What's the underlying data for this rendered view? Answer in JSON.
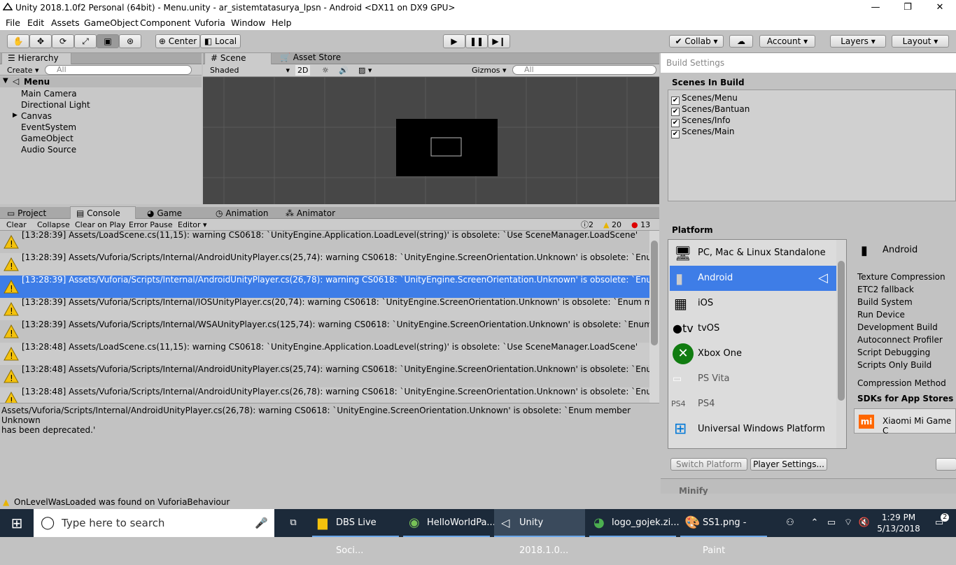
{
  "window": {
    "title": "Unity 2018.1.0f2 Personal (64bit) - Menu.unity - ar_sistemtatasurya_lpsn - Android <DX11 on DX9 GPU>"
  },
  "menu": [
    "File",
    "Edit",
    "Assets",
    "GameObject",
    "Component",
    "Vuforia",
    "Window",
    "Help"
  ],
  "toolbar": {
    "center": "Center",
    "local": "Local",
    "collab": "Collab",
    "account": "Account",
    "layers": "Layers",
    "layout": "Layout"
  },
  "hierarchy": {
    "tab": "Hierarchy",
    "create": "Create",
    "search": "All",
    "scene": "Menu",
    "items": [
      "Main Camera",
      "Directional Light",
      "Canvas",
      "EventSystem",
      "GameObject",
      "Audio Source"
    ]
  },
  "scene": {
    "tab_scene": "Scene",
    "tab_store": "Asset Store",
    "shaded": "Shaded",
    "mode2d": "2D",
    "gizmos": "Gizmos",
    "search": "All"
  },
  "console": {
    "tabs": [
      "Project",
      "Console",
      "Game",
      "Animation",
      "Animator"
    ],
    "buttons": [
      "Clear",
      "Collapse",
      "Clear on Play",
      "Error Pause",
      "Editor"
    ],
    "counts": {
      "info": "2",
      "warn": "20",
      "err": "13"
    },
    "rows": [
      "[13:28:39] Assets/LoadScene.cs(11,15): warning CS0618: `UnityEngine.Application.LoadLevel(string)' is obsolete: `Use SceneManager.LoadScene'",
      "[13:28:39] Assets/Vuforia/Scripts/Internal/AndroidUnityPlayer.cs(25,74): warning CS0618: `UnityEngine.ScreenOrientation.Unknown' is obsolete: `Enum m",
      "[13:28:39] Assets/Vuforia/Scripts/Internal/AndroidUnityPlayer.cs(26,78): warning CS0618: `UnityEngine.ScreenOrientation.Unknown' is obsolete: `Enum m",
      "[13:28:39] Assets/Vuforia/Scripts/Internal/IOSUnityPlayer.cs(20,74): warning CS0618: `UnityEngine.ScreenOrientation.Unknown' is obsolete: `Enum memb",
      "[13:28:39] Assets/Vuforia/Scripts/Internal/WSAUnityPlayer.cs(125,74): warning CS0618: `UnityEngine.ScreenOrientation.Unknown' is obsolete: `Enum mer",
      "[13:28:48] Assets/LoadScene.cs(11,15): warning CS0618: `UnityEngine.Application.LoadLevel(string)' is obsolete: `Use SceneManager.LoadScene'",
      "[13:28:48] Assets/Vuforia/Scripts/Internal/AndroidUnityPlayer.cs(25,74): warning CS0618: `UnityEngine.ScreenOrientation.Unknown' is obsolete: `Enum m",
      "[13:28:48] Assets/Vuforia/Scripts/Internal/AndroidUnityPlayer.cs(26,78): warning CS0618: `UnityEngine.ScreenOrientation.Unknown' is obsolete: `Enum m"
    ],
    "detail1": "Assets/Vuforia/Scripts/Internal/AndroidUnityPlayer.cs(26,78): warning CS0618: `UnityEngine.ScreenOrientation.Unknown' is obsolete: `Enum member Unknown",
    "detail2": "has been deprecated.'"
  },
  "build": {
    "title": "Build Settings",
    "scenes_hdr": "Scenes In Build",
    "scenes": [
      "Scenes/Menu",
      "Scenes/Bantuan",
      "Scenes/Info",
      "Scenes/Main"
    ],
    "platform_hdr": "Platform",
    "platforms": [
      "PC, Mac & Linux Standalone",
      "Android",
      "iOS",
      "tvOS",
      "Xbox One",
      "PS Vita",
      "PS4",
      "Universal Windows Platform"
    ],
    "selected": "Android",
    "options": [
      "Texture Compression",
      "ETC2 fallback",
      "Build System",
      "Run Device",
      "Development Build",
      "Autoconnect Profiler",
      "Script Debugging",
      "Scripts Only Build"
    ],
    "compression": "Compression Method",
    "sdks": "SDKs for App Stores",
    "xiaomi": "Xiaomi Mi Game C",
    "switch": "Switch Platform",
    "player": "Player Settings...",
    "minify": "Minify"
  },
  "status": "OnLevelWasLoaded was found on VuforiaBehaviour",
  "taskbar": {
    "search": "Type here to search",
    "apps": [
      "DBS Live Soci...",
      "HelloWorldPa...",
      "Unity 2018.1.0...",
      "logo_gojek.zi...",
      "SS1.png - Paint"
    ],
    "time": "1:29 PM",
    "date": "5/13/2018",
    "notif": "2"
  }
}
